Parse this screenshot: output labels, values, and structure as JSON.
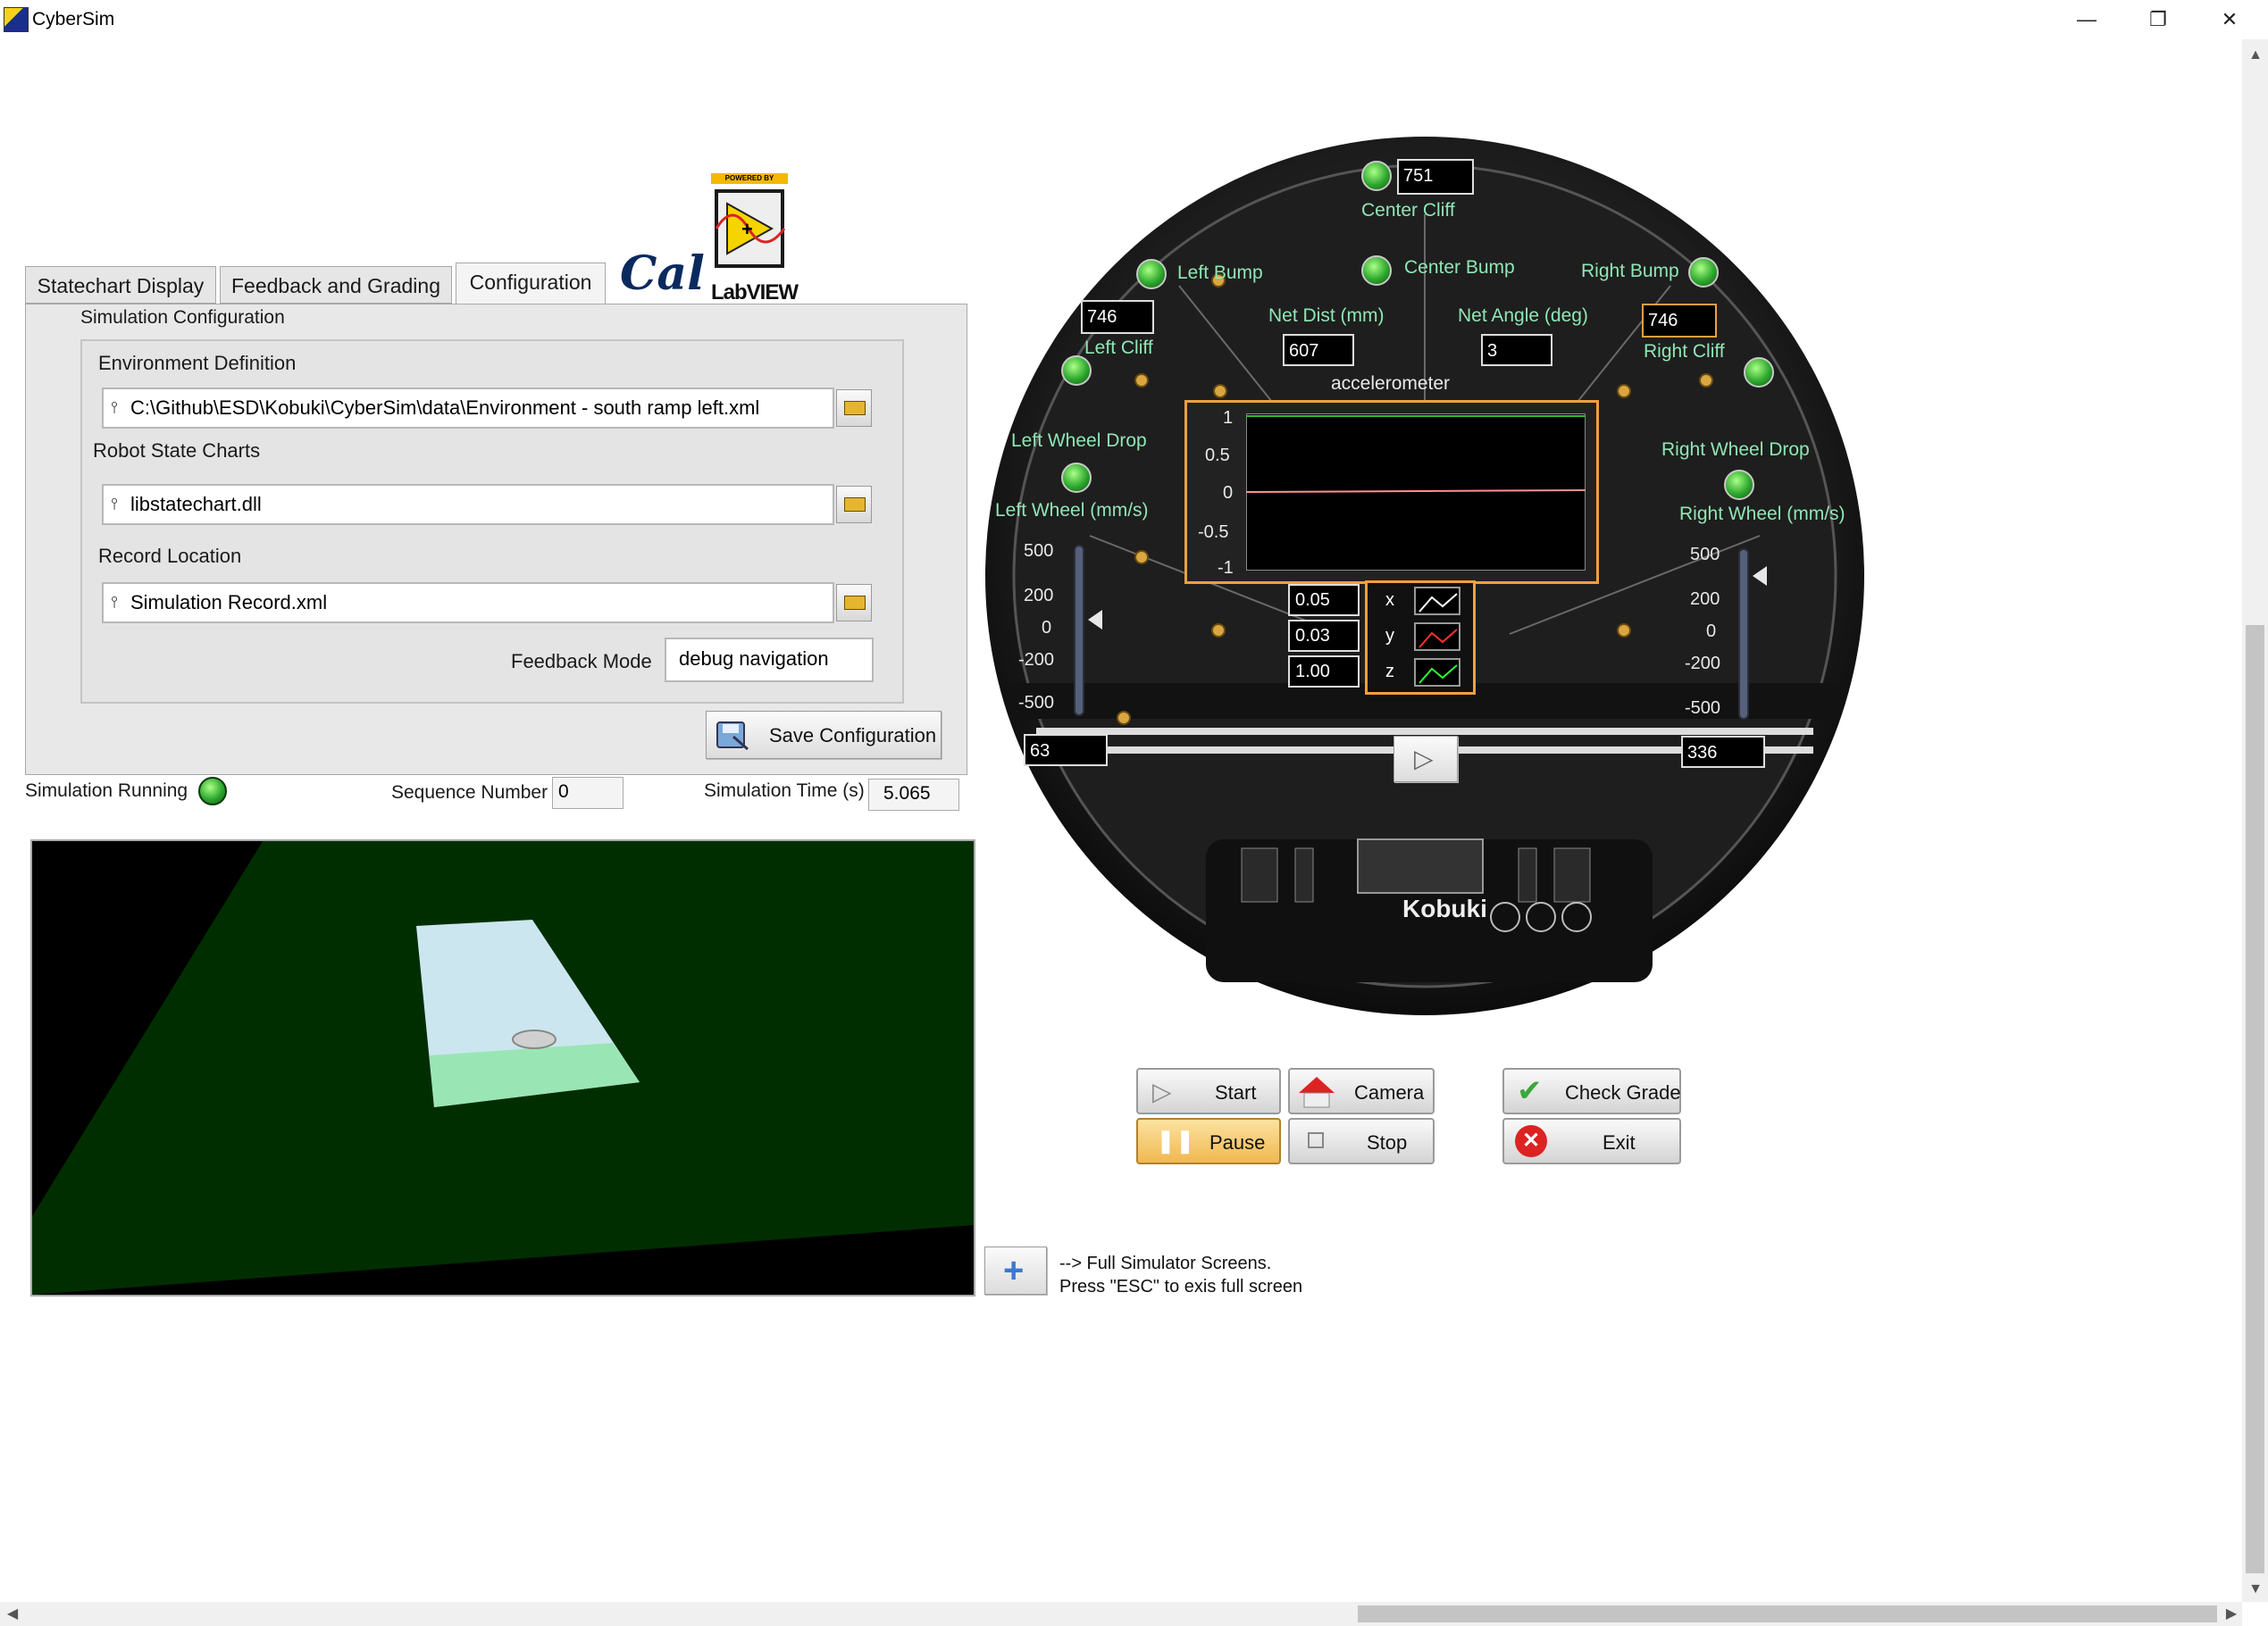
{
  "window": {
    "title": "CyberSim",
    "minimize": "—",
    "restore": "❐",
    "close": "✕"
  },
  "tabs": [
    {
      "label": "Statechart Display"
    },
    {
      "label": "Feedback and Grading"
    },
    {
      "label": "Configuration",
      "active": true
    }
  ],
  "logos": {
    "cal": "Cal",
    "powered_by": "POWERED BY",
    "labview": "LabVIEW"
  },
  "config": {
    "section_title": "Simulation Configuration",
    "environment_label": "Environment Definition",
    "environment_path": "C:\\Github\\ESD\\Kobuki\\CyberSim\\data\\Environment - south ramp left.xml",
    "statechart_label": "Robot State Charts",
    "statechart_path": "libstatechart.dll",
    "record_label": "Record Location",
    "record_path": "Simulation Record.xml",
    "feedback_mode_label": "Feedback Mode",
    "feedback_mode_value": "debug navigation",
    "save_button": "Save Configuration"
  },
  "status": {
    "running_label": "Simulation Running",
    "sequence_label": "Sequence Number",
    "sequence_value": "0",
    "time_label": "Simulation Time (s)",
    "time_value": "5.065"
  },
  "robot": {
    "center_cliff_label": "Center Cliff",
    "center_cliff_value": "751",
    "left_bump_label": "Left Bump",
    "center_bump_label": "Center Bump",
    "right_bump_label": "Right Bump",
    "left_cliff_label": "Left Cliff",
    "left_cliff_value": "746",
    "right_cliff_label": "Right Cliff",
    "right_cliff_value": "746",
    "net_dist_label": "Net Dist (mm)",
    "net_dist_value": "607",
    "net_angle_label": "Net Angle (deg)",
    "net_angle_value": "3",
    "left_wheel_drop_label": "Left Wheel Drop",
    "right_wheel_drop_label": "Right Wheel Drop",
    "left_wheel_label": "Left Wheel (mm/s)",
    "right_wheel_label": "Right Wheel (mm/s)",
    "left_wheel_value": "63",
    "right_wheel_value": "336",
    "wheel_scale": [
      "500",
      "200",
      "0",
      "-200",
      "-500"
    ],
    "left_wheel_level": 63,
    "right_wheel_level": 336,
    "kobuki_text": "Kobuki"
  },
  "accelerometer": {
    "title": "accelerometer",
    "y_ticks": [
      "1",
      "0.5",
      "0",
      "-0.5",
      "-1"
    ],
    "x_value": "0.05",
    "y_value": "0.03",
    "z_value": "1.00",
    "axis_x": "x",
    "axis_y": "y",
    "axis_z": "z",
    "trace_color": "#ff9090",
    "x_color": "#ffffff",
    "y_color": "#ff3030",
    "z_color": "#30ff30"
  },
  "controls": {
    "start": "Start",
    "camera": "Camera",
    "check_grade": "Check Grade",
    "pause": "Pause",
    "stop": "Stop",
    "exit": "Exit"
  },
  "fullscreen": {
    "line1": "--> Full Simulator Screens.",
    "line2": "Press \"ESC\" to exis full screen"
  },
  "colors": {
    "led_on": "#2ea82e",
    "robot_label": "#8fe6b4",
    "ground": "#002e00",
    "ramp": "#cce6f0",
    "ramp_base": "#99e6b4"
  }
}
